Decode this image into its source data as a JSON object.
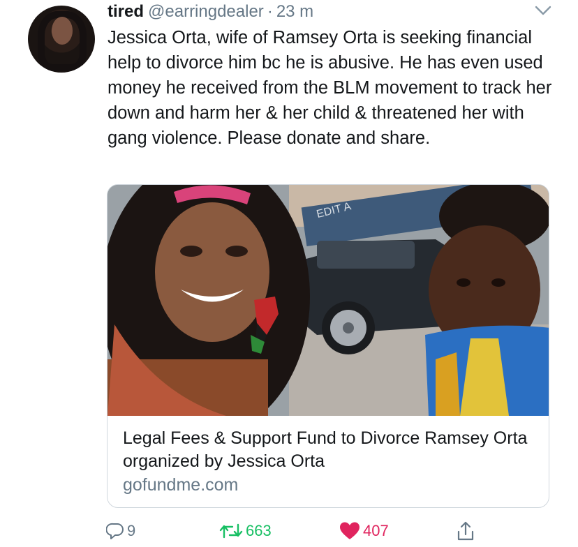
{
  "tweet": {
    "display_name": "tired",
    "handle": "@earringdealer",
    "separator": "·",
    "time": "23 m",
    "text": "Jessica Orta, wife of Ramsey Orta is seeking financial help to divorce him bc he is abusive. He has even used money he received from the BLM movement to track her down and harm her & her child & threatened her with gang violence. Please donate and share."
  },
  "card": {
    "title": "Legal Fees & Support Fund to Divorce Ramsey Orta organized by Jessica Orta",
    "domain": "gofundme.com",
    "sign_text": "EDIT A"
  },
  "actions": {
    "reply_count": "9",
    "retweet_count": "663",
    "like_count": "407"
  },
  "icons": {
    "reply": "reply-icon",
    "retweet": "retweet-icon",
    "like": "heart-icon",
    "share": "share-icon",
    "menu": "chevron-down-icon"
  },
  "colors": {
    "retweet": "#17bf63",
    "like": "#e0245e",
    "secondary_text": "#657786",
    "primary_text": "#14171a"
  }
}
